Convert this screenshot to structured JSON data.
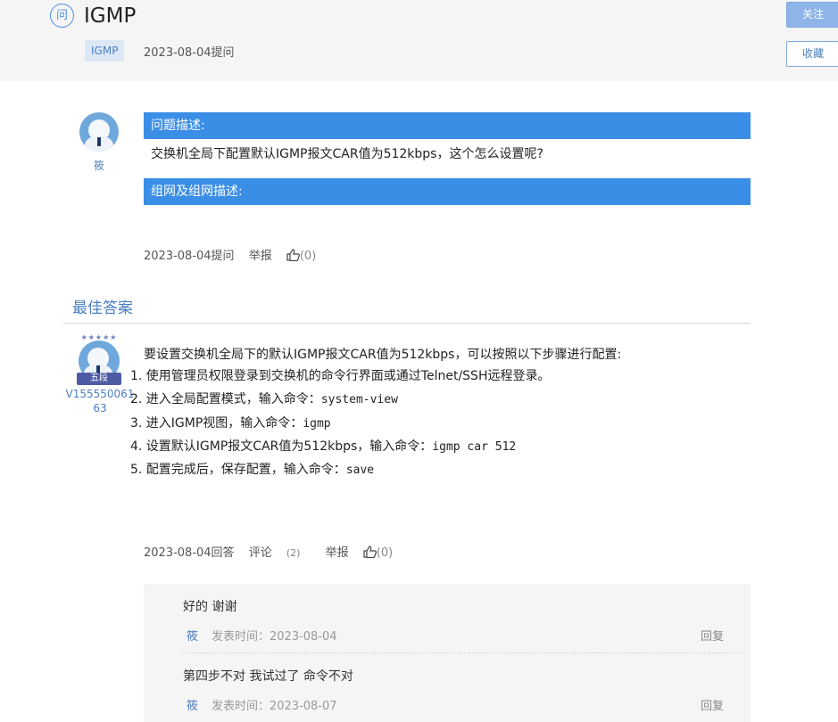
{
  "question": {
    "icon_text": "问",
    "title": "IGMP",
    "tag": "IGMP",
    "asked_date": "2023-08-04提问",
    "follow_label": "关注",
    "favorite_label": "收藏",
    "author": "筱",
    "desc_header": "问题描述:",
    "desc_body": "交换机全局下配置默认IGMP报文CAR值为512kbps，这个怎么设置呢?",
    "network_header": "组网及组网描述:",
    "meta": {
      "date": "2023-08-04提问",
      "report": "举报",
      "likes": "(0)"
    }
  },
  "best_answer": {
    "section_title": "最佳答案",
    "author": "V15555006163",
    "rank_badge": "五段",
    "stars": "★★★★★",
    "intro": "要设置交换机全局下的默认IGMP报文CAR值为512kbps，可以按照以下步骤进行配置:",
    "steps": [
      {
        "text": "1. 使用管理员权限登录到交换机的命令行界面或通过Telnet/SSH远程登录。",
        "cmd": ""
      },
      {
        "text": "2. 进入全局配置模式，输入命令：",
        "cmd": "system-view"
      },
      {
        "text": "3. 进入IGMP视图，输入命令：",
        "cmd": "igmp"
      },
      {
        "text": "4. 设置默认IGMP报文CAR值为512kbps，输入命令：",
        "cmd": "igmp car 512"
      },
      {
        "text": "5. 配置完成后，保存配置，输入命令：",
        "cmd": "save"
      }
    ],
    "meta": {
      "date": "2023-08-04回答",
      "comment": "评论",
      "comment_count": "(2)",
      "report": "举报",
      "likes": "(0)"
    }
  },
  "comments": [
    {
      "text": "好的 谢谢",
      "user": "筱",
      "time": "发表时间：2023-08-04",
      "reply": "回复"
    },
    {
      "text": "第四步不对 我试过了 命令不对",
      "user": "筱",
      "time": "发表时间：2023-08-07",
      "reply": "回复"
    }
  ],
  "colors": {
    "accent": "#3a8ee6",
    "link": "#4a7fc1",
    "header_bg": "#f5f5f5"
  }
}
